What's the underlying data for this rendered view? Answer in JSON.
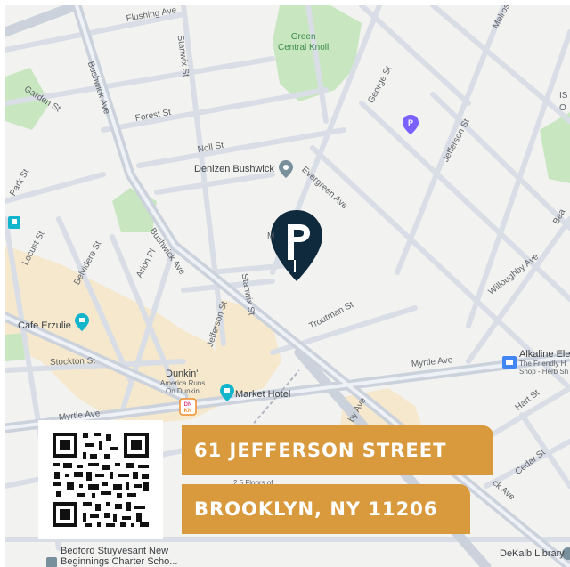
{
  "streets": {
    "flushing_ave": "Flushing Ave",
    "bushwick_ave_n": "Bushwick Ave",
    "bushwick_ave_s": "Bushwick Ave",
    "stanwix_n": "Stanwix St",
    "stanwix_s": "Stanwix St",
    "garden_st": "Garden St",
    "forest_st": "Forest St",
    "noll_st": "Noll St",
    "evergreen_ave": "Evergreen Ave",
    "george_st": "George St",
    "jefferson_st_e": "Jefferson St",
    "jefferson_st_w": "Jefferson St",
    "melrose": "Melrose",
    "flushing_partial": "Fl",
    "beaver_partial": "Bea",
    "willoughby_ave": "Willoughby Ave",
    "troutman_st": "Troutman St",
    "myrtle_ave_e": "Myrtle Ave",
    "myrtle_ave_w": "Myrtle Ave",
    "stockton_st": "Stockton St",
    "locust_st": "Locust St",
    "belvidere_st": "Belvidere St",
    "arion_pl": "Arion Pl",
    "park_st": "Park St",
    "hart_st": "Hart St",
    "cedar_st": "Cedar St",
    "dekalb_partial": "ck Ave",
    "stanhope_partial": "on St",
    "dby_partial": "by Ave",
    "m_partial": "M"
  },
  "places": {
    "green_central_knoll": "Green\nCentral Knoll",
    "denizen_bushwick": "Denizen Bushwick",
    "cafe_erzulie": "Cafe Erzulie",
    "dunkin": "Dunkin'",
    "dunkin_sub1": "America Runs",
    "dunkin_sub2": "On Dunkin",
    "market_hotel": "Market Hotel",
    "alkaline_title": "Alkaline Ele",
    "alkaline_sub1": "The Friendly H",
    "alkaline_sub2": "Shop - Herb Sh",
    "dekalb_library": "DeKalb Library",
    "bedford_line1": "Bedford Stuyvesant New",
    "bedford_line2": "Beginnings Charter Scho...",
    "floors_partial": "2.5 Floors of",
    "is_partial": "IS",
    "o_partial": "O",
    "dunkin_logo": "DN\nKN"
  },
  "address": {
    "line1": "61 JEFFERSON STREET",
    "line2": "BROOKLYN, NY 11206"
  },
  "icons": {
    "marker": "property-location-pin-icon",
    "qr": "qr-code-icon",
    "poi": "place-pin-icon",
    "parking": "parking-icon",
    "transit": "transit-icon"
  },
  "colors": {
    "map_bg": "#f2f2f0",
    "road": "#d5dbe3",
    "major_road": "#c7ced8",
    "park": "#c8e6c0",
    "commercial": "#f6e8cc",
    "marker": "#0f2a3c",
    "banner": "#d99a3e",
    "poi_grey": "#78909c",
    "poi_teal": "#12b5cb",
    "parking": "#7b61ff"
  }
}
